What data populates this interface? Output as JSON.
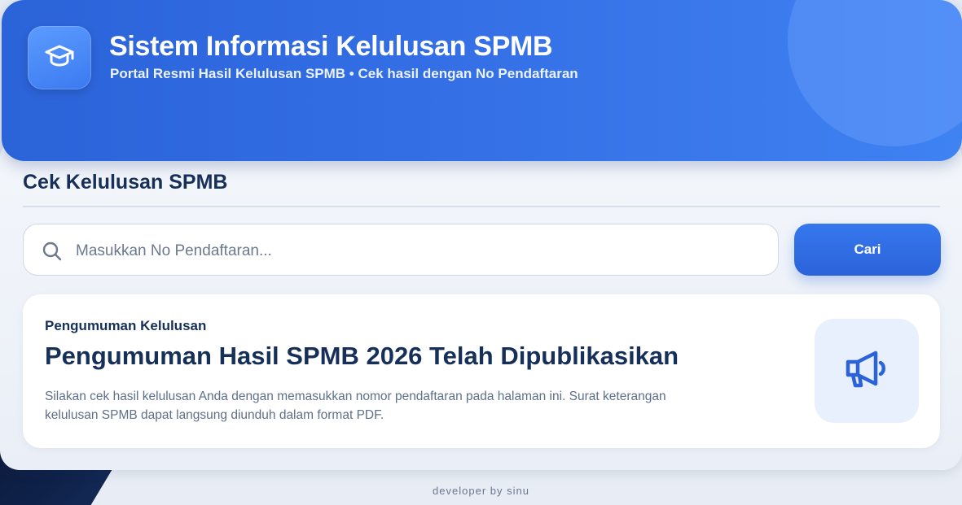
{
  "header": {
    "title": "Sistem Informasi Kelulusan SPMB",
    "subtitle": "Portal Resmi Hasil Kelulusan SPMB • Cek hasil dengan No Pendaftaran",
    "logo_icon": "graduation-cap-icon"
  },
  "main": {
    "section_title": "Cek Kelulusan SPMB",
    "search": {
      "placeholder": "Masukkan No Pendaftaran...",
      "value": "",
      "icon": "search-icon",
      "button_label": "Cari"
    },
    "announcement": {
      "label": "Pengumuman Kelulusan",
      "title": "Pengumuman Hasil SPMB 2026 Telah Dipublikasikan",
      "body": "Silakan cek hasil kelulusan Anda dengan memasukkan nomor pendaftaran pada halaman ini. Surat keterangan kelulusan SPMB dapat langsung diunduh dalam format PDF.",
      "icon": "megaphone-icon"
    }
  },
  "footer": {
    "text": "developer by sinu"
  },
  "colors": {
    "primary": "#2b63d9",
    "heading": "#16305a",
    "muted": "#5e6f8a"
  }
}
